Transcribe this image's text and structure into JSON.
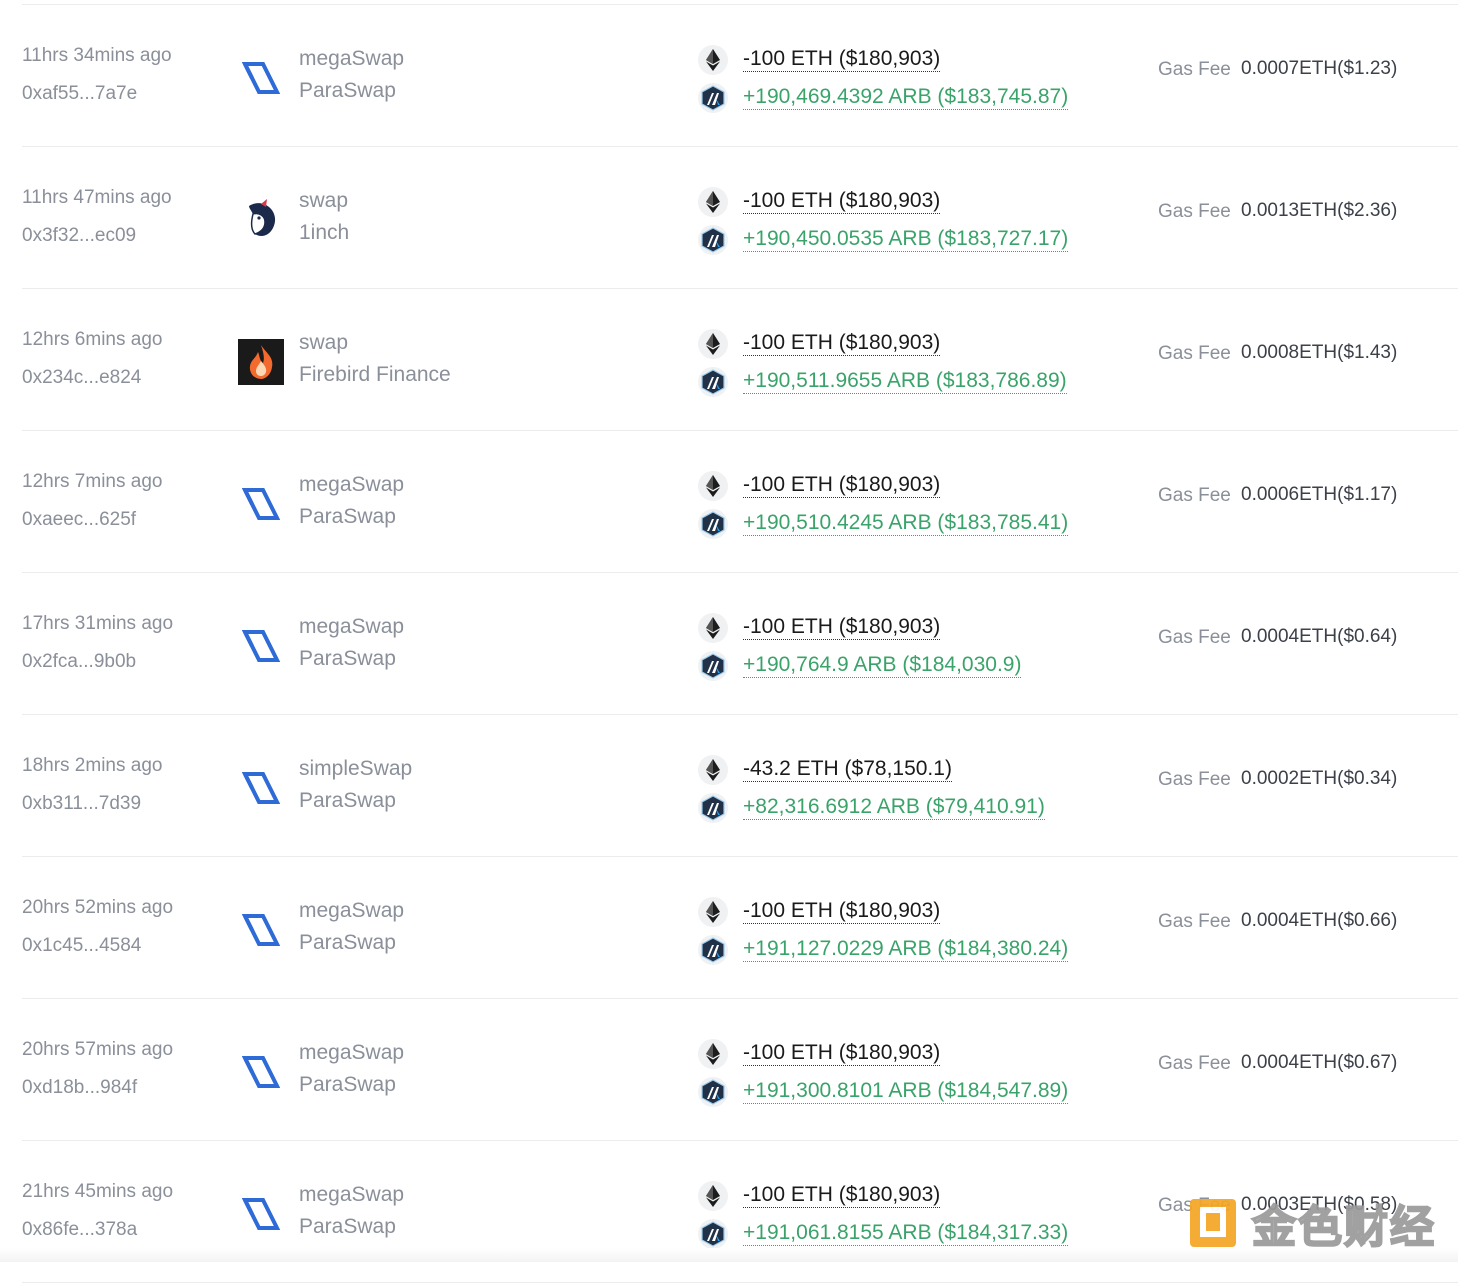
{
  "labels": {
    "gas_fee": "Gas Fee"
  },
  "colors": {
    "positive": "#3aa36a",
    "muted": "#8a8f99",
    "paraswap_blue": "#2f6bd6"
  },
  "rows": [
    {
      "time": "11hrs 34mins ago",
      "hash": "0xaf55...7a7e",
      "method": "megaSwap",
      "protocol": "ParaSwap",
      "logo": "paraswap-icon",
      "out": "-100 ETH ($180,903)",
      "in": "+190,469.4392 ARB ($183,745.87)",
      "gas": "0.0007ETH($1.23)"
    },
    {
      "time": "11hrs 47mins ago",
      "hash": "0x3f32...ec09",
      "method": "swap",
      "protocol": "1inch",
      "logo": "oneinch-icon",
      "out": "-100 ETH ($180,903)",
      "in": "+190,450.0535 ARB ($183,727.17)",
      "gas": "0.0013ETH($2.36)"
    },
    {
      "time": "12hrs 6mins ago",
      "hash": "0x234c...e824",
      "method": "swap",
      "protocol": "Firebird Finance",
      "logo": "firebird-icon",
      "out": "-100 ETH ($180,903)",
      "in": "+190,511.9655 ARB ($183,786.89)",
      "gas": "0.0008ETH($1.43)"
    },
    {
      "time": "12hrs 7mins ago",
      "hash": "0xaeec...625f",
      "method": "megaSwap",
      "protocol": "ParaSwap",
      "logo": "paraswap-icon",
      "out": "-100 ETH ($180,903)",
      "in": "+190,510.4245 ARB ($183,785.41)",
      "gas": "0.0006ETH($1.17)"
    },
    {
      "time": "17hrs 31mins ago",
      "hash": "0x2fca...9b0b",
      "method": "megaSwap",
      "protocol": "ParaSwap",
      "logo": "paraswap-icon",
      "out": "-100 ETH ($180,903)",
      "in": "+190,764.9 ARB ($184,030.9)",
      "gas": "0.0004ETH($0.64)"
    },
    {
      "time": "18hrs 2mins ago",
      "hash": "0xb311...7d39",
      "method": "simpleSwap",
      "protocol": "ParaSwap",
      "logo": "paraswap-icon",
      "out": "-43.2 ETH ($78,150.1)",
      "in": "+82,316.6912 ARB ($79,410.91)",
      "gas": "0.0002ETH($0.34)"
    },
    {
      "time": "20hrs 52mins ago",
      "hash": "0x1c45...4584",
      "method": "megaSwap",
      "protocol": "ParaSwap",
      "logo": "paraswap-icon",
      "out": "-100 ETH ($180,903)",
      "in": "+191,127.0229 ARB ($184,380.24)",
      "gas": "0.0004ETH($0.66)"
    },
    {
      "time": "20hrs 57mins ago",
      "hash": "0xd18b...984f",
      "method": "megaSwap",
      "protocol": "ParaSwap",
      "logo": "paraswap-icon",
      "out": "-100 ETH ($180,903)",
      "in": "+191,300.8101 ARB ($184,547.89)",
      "gas": "0.0004ETH($0.67)"
    },
    {
      "time": "21hrs 45mins ago",
      "hash": "0x86fe...378a",
      "method": "megaSwap",
      "protocol": "ParaSwap",
      "logo": "paraswap-icon",
      "out": "-100 ETH ($180,903)",
      "in": "+191,061.8155 ARB ($184,317.33)",
      "gas": "0.0003ETH($0.58)"
    }
  ],
  "watermark": {
    "text": "金色财经",
    "icon": "jinse-logo-icon"
  }
}
